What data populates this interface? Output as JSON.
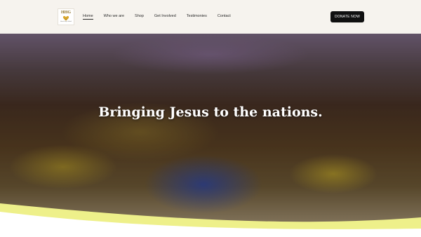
{
  "logo": {
    "text": "HHG",
    "tagline": "Heart Help Global"
  },
  "nav": [
    {
      "label": "Home",
      "active": true
    },
    {
      "label": "Who we are",
      "active": false
    },
    {
      "label": "Shop",
      "active": false
    },
    {
      "label": "Get Involved",
      "active": false
    },
    {
      "label": "Testimonies",
      "active": false
    },
    {
      "label": "Contact",
      "active": false
    }
  ],
  "donate_label": "DONATE NOW",
  "hero": {
    "heading": "Bringing Jesus to the nations.",
    "image": "photo-children-classroom"
  },
  "colors": {
    "header_bg": "#f6f3ee",
    "button_bg": "#101010",
    "wave": "#eef08a",
    "logo_gold": "#d8a62a"
  }
}
